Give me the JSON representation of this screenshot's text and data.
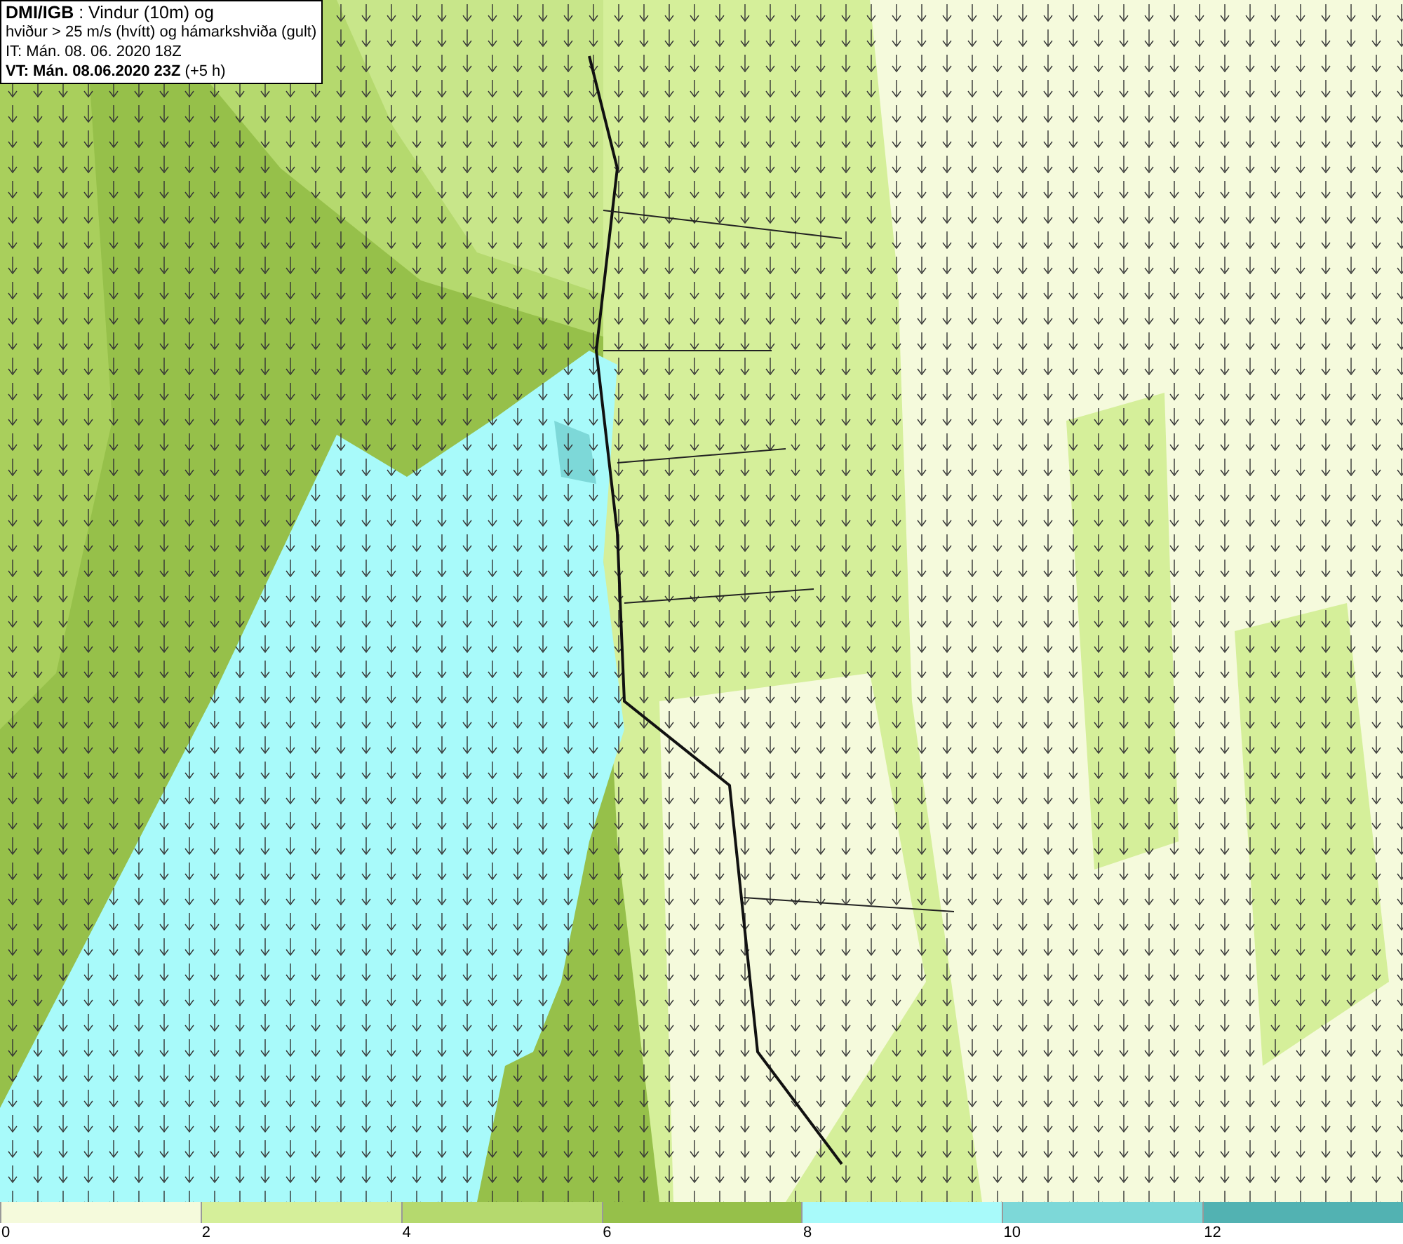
{
  "title_box": {
    "lines": [
      "**DMI/IGB** : Vindur (10m) og",
      "hviður > 25 m/s (hvítt) og hámarkshviða (gult)",
      "IT: Mán. 08. 06. 2020 18Z",
      "**VT: Mán. 08.06.2020 23Z** (+5 h)"
    ]
  },
  "legend": {
    "bins": [
      {
        "color": "#f5fadc",
        "label": "0"
      },
      {
        "color": "#d5ef9a",
        "label": "2"
      },
      {
        "color": "#b5d96e",
        "label": "4"
      },
      {
        "color": "#96c04a",
        "label": "6"
      },
      {
        "color": "#a8fafa",
        "label": "8"
      },
      {
        "color": "#7dd8d8",
        "label": "10"
      },
      {
        "color": "#52b2b2",
        "label": "12"
      }
    ]
  }
}
